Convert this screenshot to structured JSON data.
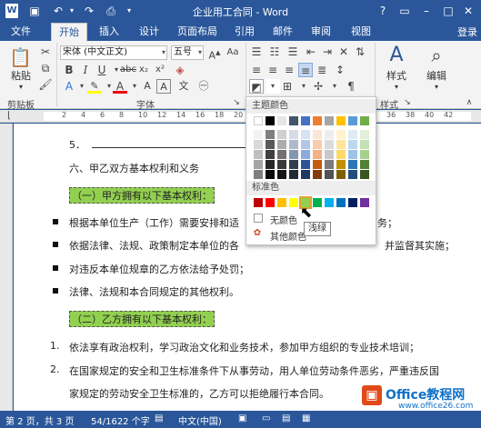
{
  "window": {
    "title": "企业用工合同 - Word",
    "help": "?",
    "login": "登录"
  },
  "tabs": [
    "文件",
    "开始",
    "插入",
    "设计",
    "页面布局",
    "引用",
    "邮件",
    "审阅",
    "视图"
  ],
  "ribbon": {
    "paste": "粘贴",
    "clipboard": "剪贴板",
    "font_name": "宋体 (中文正文)",
    "font_size": "五号",
    "font_group": "字体",
    "styles": "样式",
    "editing": "编辑",
    "styles_group": "样式"
  },
  "ruler": {
    "marks": [
      "2",
      "4",
      "6",
      "8",
      "10",
      "12",
      "14",
      "16",
      "18",
      "20",
      "22",
      "24",
      "26",
      "28",
      "30",
      "32",
      "34",
      "36",
      "38",
      "40",
      "42"
    ]
  },
  "doc": {
    "line5": "5．",
    "line6": "六、甲乙双方基本权利和义务",
    "heading1": "（一）甲方拥有以下基本权利：",
    "b1": "根据本单位生产（工作）需要安排和适",
    "b1_tail": "务；",
    "b2": "依据法律、法规、政策制定本单位的各",
    "b2_tail": "并监督其实施；",
    "b3": "对违反本单位规章的乙方依法给予处罚；",
    "b4": "法律、法规和本合同规定的其他权利。",
    "heading2": "（二）乙方拥有以下基本权利：",
    "n1_num": "1.",
    "n1": "依法享有政治权利，学习政治文化和业务技术，参加甲方组织的专业技术培训；",
    "n2_num": "2.",
    "n2": "在国家规定的安全和卫生标准条件下从事劳动，用人单位劳动条件恶劣，严重违反国",
    "n3": "家规定的劳动安全卫生标准的，乙方可以拒绝履行本合同。"
  },
  "color_menu": {
    "theme_title": "主题颜色",
    "standard_title": "标准色",
    "no_color": "无颜色",
    "more_colors": "其他颜色",
    "tooltip": "浅绿",
    "theme_top": [
      "#ffffff",
      "#000000",
      "#e7e6e6",
      "#44546a",
      "#4472c4",
      "#ed7d31",
      "#a5a5a5",
      "#ffc000",
      "#5b9bd5",
      "#70ad47"
    ],
    "theme_shades": [
      [
        "#f2f2f2",
        "#7f7f7f",
        "#d0cece",
        "#d6dce4",
        "#d9e2f3",
        "#fbe5d5",
        "#ededed",
        "#fff2cc",
        "#deebf6",
        "#e2efd9"
      ],
      [
        "#d8d8d8",
        "#595959",
        "#aeabab",
        "#adb9ca",
        "#b4c6e7",
        "#f7cbac",
        "#dbdbdb",
        "#fee599",
        "#bdd7ee",
        "#c5e0b3"
      ],
      [
        "#bfbfbf",
        "#3f3f3f",
        "#757070",
        "#8496b0",
        "#8eaadb",
        "#f4b183",
        "#c9c9c9",
        "#ffd965",
        "#9dc3e6",
        "#a8d08d"
      ],
      [
        "#a5a5a5",
        "#262626",
        "#3a3838",
        "#323f4f",
        "#2f5496",
        "#c55a11",
        "#7b7b7b",
        "#bf9000",
        "#2e75b5",
        "#538135"
      ],
      [
        "#7f7f7f",
        "#0c0c0c",
        "#171616",
        "#222a35",
        "#1f3864",
        "#833c0b",
        "#525252",
        "#7f6000",
        "#1e4e79",
        "#375623"
      ]
    ],
    "standard": [
      "#c00000",
      "#ff0000",
      "#ffc000",
      "#ffff00",
      "#92d050",
      "#00b050",
      "#00b0f0",
      "#0070c0",
      "#002060",
      "#7030a0"
    ],
    "selected_index": 4
  },
  "status": {
    "page": "第 2 页，共 3 页",
    "words": "54/1622 个字",
    "lang": "中文(中国)"
  },
  "watermark": {
    "brand": "Office教程网",
    "url": "www.office26.com"
  }
}
